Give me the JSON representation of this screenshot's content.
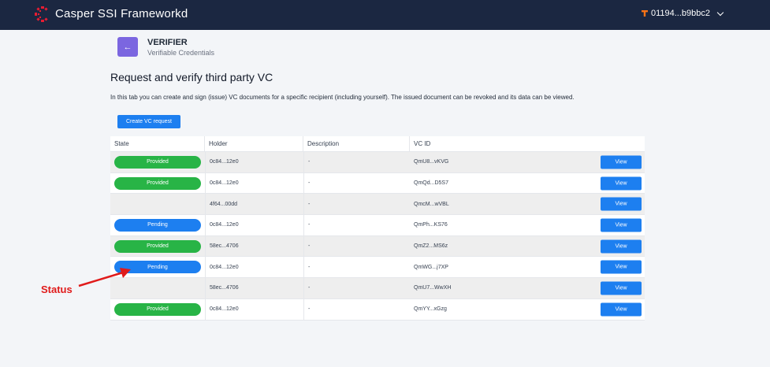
{
  "header": {
    "brand": "Casper SSI Frameworkd",
    "account": "01194...b9bbc2",
    "brand_color": "#1b2741",
    "logo_color": "#e51d33"
  },
  "page": {
    "role_title": "VERIFIER",
    "role_subtitle": "Verifiable Credentials",
    "heading": "Request and verify third party VC",
    "intro": "In this tab you can create and sign (issue) VC documents for a specific recipient (including yourself). The issued document can be revoked and its data can be viewed.",
    "create_button": "Create VC request"
  },
  "table": {
    "headers": [
      "State",
      "Holder",
      "Description",
      "VC ID"
    ],
    "rows": [
      {
        "state": "Provided",
        "holder": "0c84...12e0",
        "description": "-",
        "vc_id": "QmU8...vKVG",
        "action": "View"
      },
      {
        "state": "Provided",
        "holder": "0c84...12e0",
        "description": "-",
        "vc_id": "QmQd...D5S7",
        "action": "View"
      },
      {
        "state": "",
        "holder": "4f64...00dd",
        "description": "-",
        "vc_id": "QmcM...wVBL",
        "action": "View"
      },
      {
        "state": "Pending",
        "holder": "0c84...12e0",
        "description": "-",
        "vc_id": "QmPh...KS76",
        "action": "View"
      },
      {
        "state": "Provided",
        "holder": "58ec...4706",
        "description": "-",
        "vc_id": "QmZ2...MS6z",
        "action": "View"
      },
      {
        "state": "Pending",
        "holder": "0c84...12e0",
        "description": "-",
        "vc_id": "QmWG...j7XP",
        "action": "View"
      },
      {
        "state": "",
        "holder": "58ec...4706",
        "description": "-",
        "vc_id": "QmU7...WwXH",
        "action": "View"
      },
      {
        "state": "Provided",
        "holder": "0c84...12e0",
        "description": "-",
        "vc_id": "QmYY...xGzg",
        "action": "View"
      }
    ]
  },
  "annotation": {
    "label": "Status",
    "color": "#e01b1b"
  },
  "colors": {
    "provided": "#28b446",
    "pending": "#1d7ff0",
    "button": "#1d7ff0",
    "back_button": "#7b66e0"
  }
}
